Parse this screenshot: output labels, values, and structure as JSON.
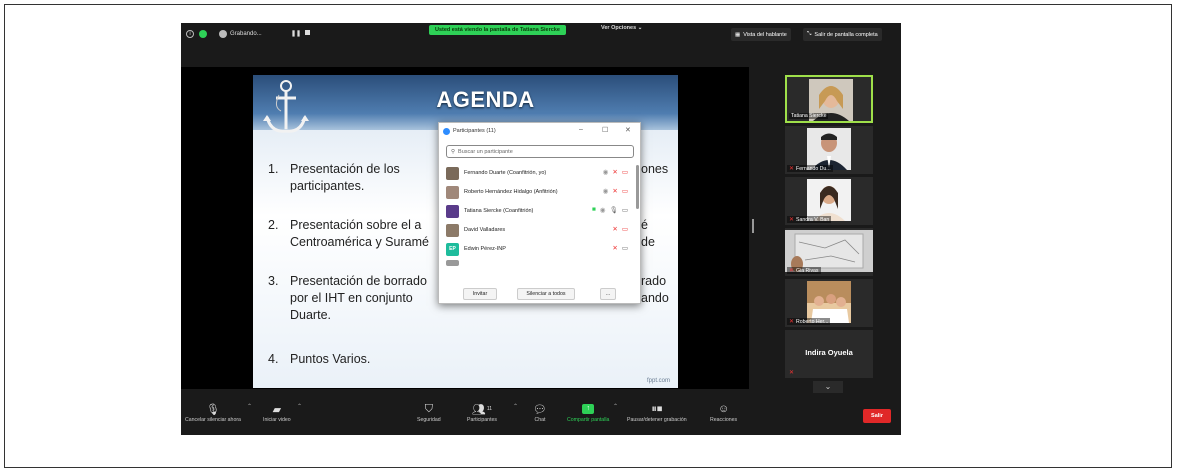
{
  "topbar": {
    "recording_label": "Grabando...",
    "viewing_banner": "Usted está viendo la pantalla de Tatiana Siercke",
    "view_options": "Ver Opciones",
    "speaker_view": "Vista del hablante",
    "exit_fullscreen": "Salir de pantalla completa"
  },
  "slide": {
    "title": "AGENDA",
    "items": [
      {
        "num": "1.",
        "line1": "Presentación   de   los",
        "line1b": "ones",
        "line2": "participantes."
      },
      {
        "num": "2.",
        "line1": "Presentación sobre el a",
        "line1b": "é de",
        "line2": "Centroamérica y Suramé"
      },
      {
        "num": "3.",
        "line1": "Presentación de borrado",
        "line1b": "rado",
        "line2": "por el IHT en conjunto",
        "line2b": "ando",
        "line3": "Duarte."
      },
      {
        "num": "4.",
        "line1": "Puntos Varios."
      }
    ],
    "footer": "fppt.com"
  },
  "participants": {
    "title": "Participantes (11)",
    "search_placeholder": "Buscar un participante",
    "rows": [
      {
        "name": "Fernando Duarte (Coanfitrión, yo)"
      },
      {
        "name": "Roberto Hernández Hidalgo (Anfitrión)"
      },
      {
        "name": "Tatiana Siercke (Coanfitrión)"
      },
      {
        "name": "David Valladares"
      },
      {
        "name": "Edwin Pérez-INP",
        "initials": "EP"
      }
    ],
    "invite": "Invitar",
    "mute_all": "Silenciar a todos",
    "more": "..."
  },
  "gallery": [
    {
      "name": "Tatiana Siercke"
    },
    {
      "name": "Fernando Du..."
    },
    {
      "name": "Sandra V. Ban"
    },
    {
      "name": "Gia Rivas"
    },
    {
      "name": "Roberto Her..."
    },
    {
      "name": "Indira Oyuela"
    }
  ],
  "toolbar": {
    "unmute": "Cancelar silenciar ahora",
    "start_video": "Iniciar video",
    "security": "Seguridad",
    "participants": "Participantes",
    "participants_count": "11",
    "chat": "Chat",
    "share": "Compartir pantalla",
    "record": "Pausar/detener grabación",
    "reactions": "Reacciones",
    "leave": "Salir"
  },
  "colors": {
    "banner_green": "#2ed157",
    "leave_red": "#e02828",
    "active_border": "#9fe04a"
  }
}
